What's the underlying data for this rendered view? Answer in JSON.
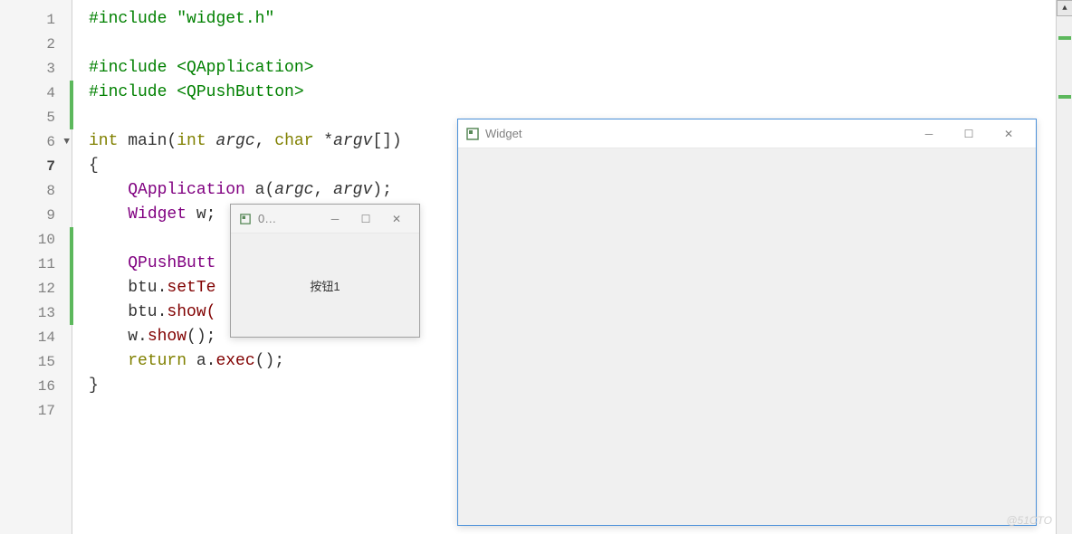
{
  "editor": {
    "lines": [
      {
        "num": "1"
      },
      {
        "num": "2"
      },
      {
        "num": "3"
      },
      {
        "num": "4",
        "changed": true
      },
      {
        "num": "5",
        "changed": true
      },
      {
        "num": "6",
        "fold": true
      },
      {
        "num": "7",
        "current": true
      },
      {
        "num": "8"
      },
      {
        "num": "9"
      },
      {
        "num": "10",
        "changed": true
      },
      {
        "num": "11",
        "changed": true
      },
      {
        "num": "12",
        "changed": true
      },
      {
        "num": "13",
        "changed": true
      },
      {
        "num": "14"
      },
      {
        "num": "15"
      },
      {
        "num": "16"
      },
      {
        "num": "17"
      }
    ],
    "code": {
      "l1a": "#include",
      "l1b": " ",
      "l1c": "\"widget.h\"",
      "l3a": "#include",
      "l3b": " ",
      "l3c": "<QApplication>",
      "l4a": "#include",
      "l4b": " ",
      "l4c": "<QPushButton>",
      "l6a": "int",
      "l6b": " main(",
      "l6c": "int",
      "l6d": " argc, ",
      "l6e": "char",
      "l6f": " *argv[])",
      "l6arg1": "argc",
      "l6arg2": "argv",
      "l7a": "{",
      "l8a": "    ",
      "l8b": "QApplication",
      "l8c": " a(",
      "l8d": "argc",
      "l8e": ", ",
      "l8f": "argv",
      "l8g": ");",
      "l9a": "    ",
      "l9b": "Widget",
      "l9c": " w;",
      "l11a": "    ",
      "l11b": "QPushButt",
      "l12a": "    btu.",
      "l12b": "setTe",
      "l13a": "    btu.",
      "l13b": "show(",
      "l14a": "    w.",
      "l14b": "show",
      "l14c": "();",
      "l15a": "    ",
      "l15b": "return",
      "l15c": " a.",
      "l15d": "exec",
      "l15e": "();",
      "l16a": "}"
    }
  },
  "widget_window": {
    "title": "Widget"
  },
  "button_window": {
    "title": "0…",
    "button_label": "按钮1"
  },
  "watermark": "@51CTO"
}
